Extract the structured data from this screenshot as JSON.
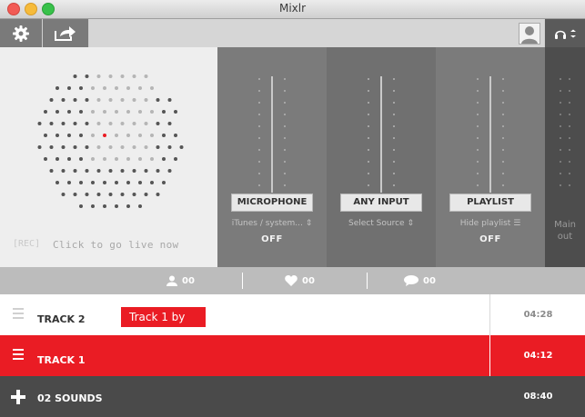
{
  "window": {
    "title": "Mixlr"
  },
  "toolbar": {
    "settings_icon": "gear-icon",
    "share_icon": "share-icon",
    "avatar_icon": "user-avatar-icon",
    "headphones_icon": "headphones-icon"
  },
  "live_pad": {
    "rec_label": "[REC]",
    "golive_label": "Click to go live now"
  },
  "channels": [
    {
      "name": "MICROPHONE",
      "source": "iTunes / system...",
      "state": "OFF"
    },
    {
      "name": "ANY INPUT",
      "source": "Select Source",
      "state": ""
    },
    {
      "name": "PLAYLIST",
      "source": "Hide playlist",
      "state": "OFF"
    }
  ],
  "main_out": {
    "label_line1": "Main",
    "label_line2": "out"
  },
  "stats": {
    "listeners": "00",
    "hearts": "00",
    "comments": "00"
  },
  "tracks": [
    {
      "label": "TRACK 2",
      "time": "04:28"
    },
    {
      "label": "TRACK 1",
      "time": "04:12"
    }
  ],
  "tooltip": {
    "text": "Track 1 by"
  },
  "sounds": {
    "label": "02 SOUNDS",
    "time": "08:40"
  },
  "colors": {
    "accent": "#ea1c24",
    "dark": "#4a4a4a"
  }
}
